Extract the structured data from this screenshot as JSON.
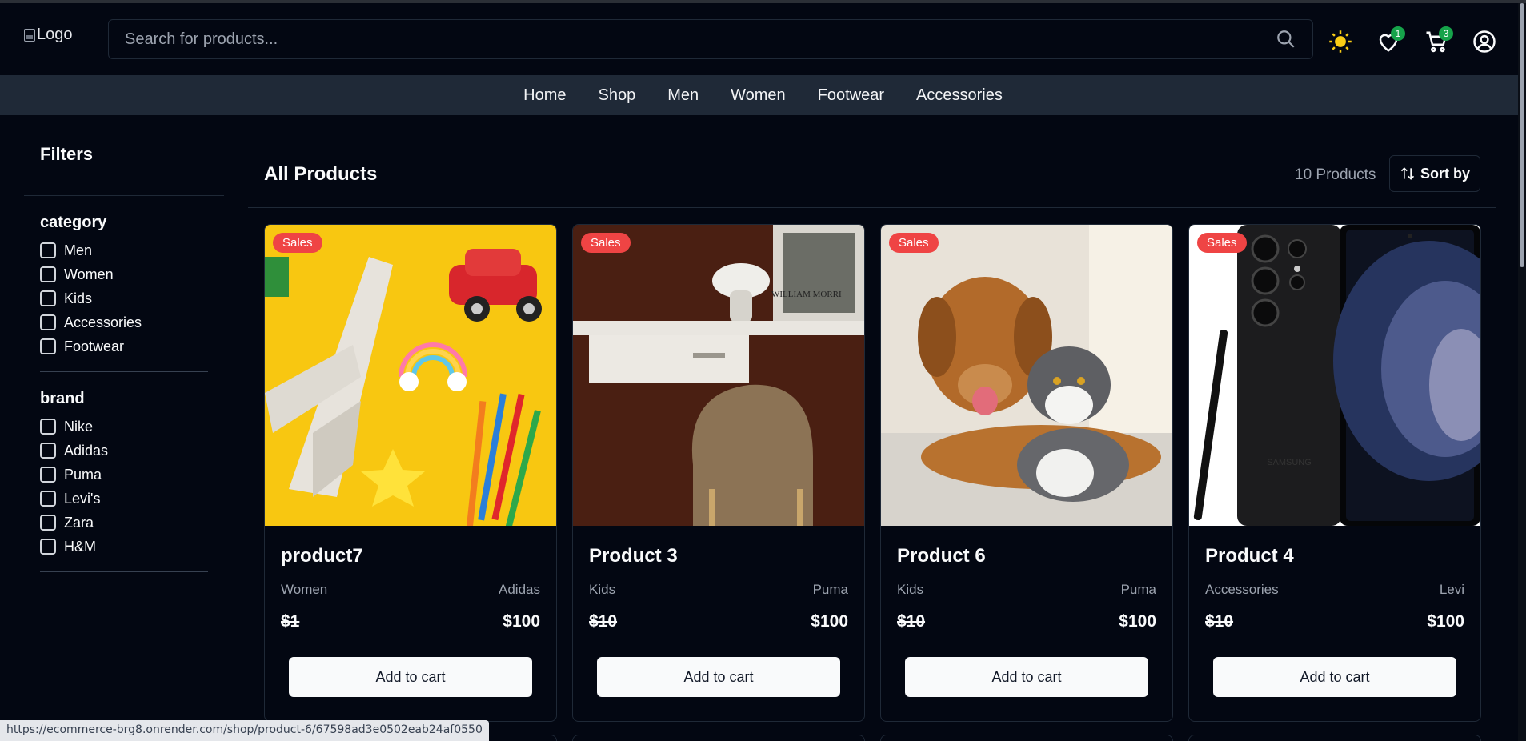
{
  "header": {
    "logo_alt": "Logo",
    "search_placeholder": "Search for products...",
    "wishlist_count": "1",
    "cart_count": "3"
  },
  "nav": [
    "Home",
    "Shop",
    "Men",
    "Women",
    "Footwear",
    "Accessories"
  ],
  "filters": {
    "title": "Filters",
    "category": {
      "title": "category",
      "options": [
        "Men",
        "Women",
        "Kids",
        "Accessories",
        "Footwear"
      ]
    },
    "brand": {
      "title": "brand",
      "options": [
        "Nike",
        "Adidas",
        "Puma",
        "Levi's",
        "Zara",
        "H&M"
      ]
    }
  },
  "main": {
    "title": "All Products",
    "count": "10 Products",
    "sort_label": "Sort by"
  },
  "products": [
    {
      "badge": "Sales",
      "name": "product7",
      "category": "Women",
      "brand": "Adidas",
      "old_price": "$1",
      "price": "$100",
      "button": "Add to cart"
    },
    {
      "badge": "Sales",
      "name": "Product 3",
      "category": "Kids",
      "brand": "Puma",
      "old_price": "$10",
      "price": "$100",
      "button": "Add to cart"
    },
    {
      "badge": "Sales",
      "name": "Product 6",
      "category": "Kids",
      "brand": "Puma",
      "old_price": "$10",
      "price": "$100",
      "button": "Add to cart"
    },
    {
      "badge": "Sales",
      "name": "Product 4",
      "category": "Accessories",
      "brand": "Levi",
      "old_price": "$10",
      "price": "$100",
      "button": "Add to cart"
    }
  ],
  "image_text": {
    "desk_poster": "WILLIAM MORRI",
    "phone_brand": "SAMSUNG"
  },
  "status_url": "https://ecommerce-brg8.onrender.com/shop/product-6/67598ad3e0502eab24af0550",
  "colors": {
    "background": "#030712",
    "nav": "#1f2937",
    "sale": "#ef4444",
    "badge": "#16a34a",
    "sun": "#facc15"
  }
}
